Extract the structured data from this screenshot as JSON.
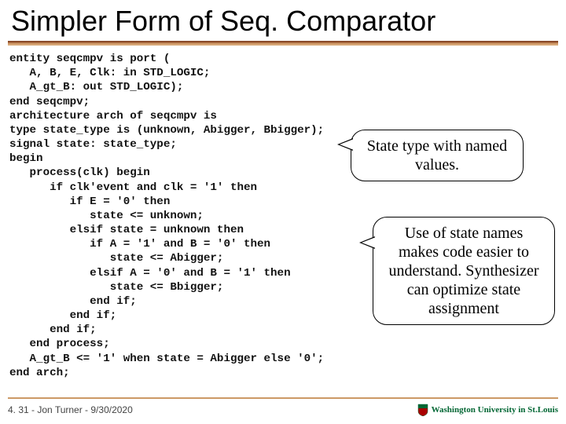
{
  "title": "Simpler Form of Seq. Comparator",
  "code": "entity seqcmpv is port (\n   A, B, E, Clk: in STD_LOGIC;\n   A_gt_B: out STD_LOGIC);\nend seqcmpv;\narchitecture arch of seqcmpv is\ntype state_type is (unknown, Abigger, Bbigger);\nsignal state: state_type;\nbegin\n   process(clk) begin\n      if clk'event and clk = '1' then\n         if E = '0' then\n            state <= unknown;\n         elsif state = unknown then\n            if A = '1' and B = '0' then\n               state <= Abigger;\n            elsif A = '0' and B = '1' then\n               state <= Bbigger;\n            end if;\n         end if;\n      end if;\n   end process;\n   A_gt_B <= '1' when state = Abigger else '0';\nend arch;",
  "callouts": {
    "c1": "State type with named values.",
    "c2": "Use of state names makes code easier to understand. Synthesizer can optimize state assignment"
  },
  "footer": {
    "left": "4. 31 - Jon Turner - 9/30/2020",
    "right": "Washington University in St.Louis"
  }
}
